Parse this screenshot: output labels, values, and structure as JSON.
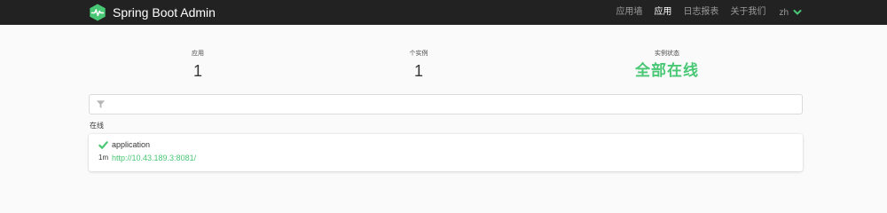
{
  "brand": {
    "title": "Spring Boot Admin"
  },
  "nav": {
    "items": [
      {
        "label": "应用墙",
        "active": false
      },
      {
        "label": "应用",
        "active": true
      },
      {
        "label": "日志报表",
        "active": false
      },
      {
        "label": "关于我们",
        "active": false
      }
    ],
    "language": "zh"
  },
  "stats": {
    "applications": {
      "label": "应用",
      "value": "1"
    },
    "instances": {
      "label": "个实例",
      "value": "1"
    },
    "status": {
      "label": "实例状态",
      "value": "全部在线"
    }
  },
  "filter": {
    "value": "",
    "placeholder": ""
  },
  "group": {
    "title": "在线",
    "applications": [
      {
        "name": "application",
        "uptime": "1m",
        "url": "http://10.43.189.3:8081/",
        "status": "up"
      }
    ]
  },
  "colors": {
    "navbar": "#222222",
    "accent": "#48c774",
    "nav_text": "#9a9a9a",
    "background": "#fafafa"
  },
  "icons": {
    "logo": "heartbeat-logo-icon",
    "filter": "filter-icon",
    "status": "checkmark-icon",
    "dropdown": "chevron-down-icon"
  }
}
